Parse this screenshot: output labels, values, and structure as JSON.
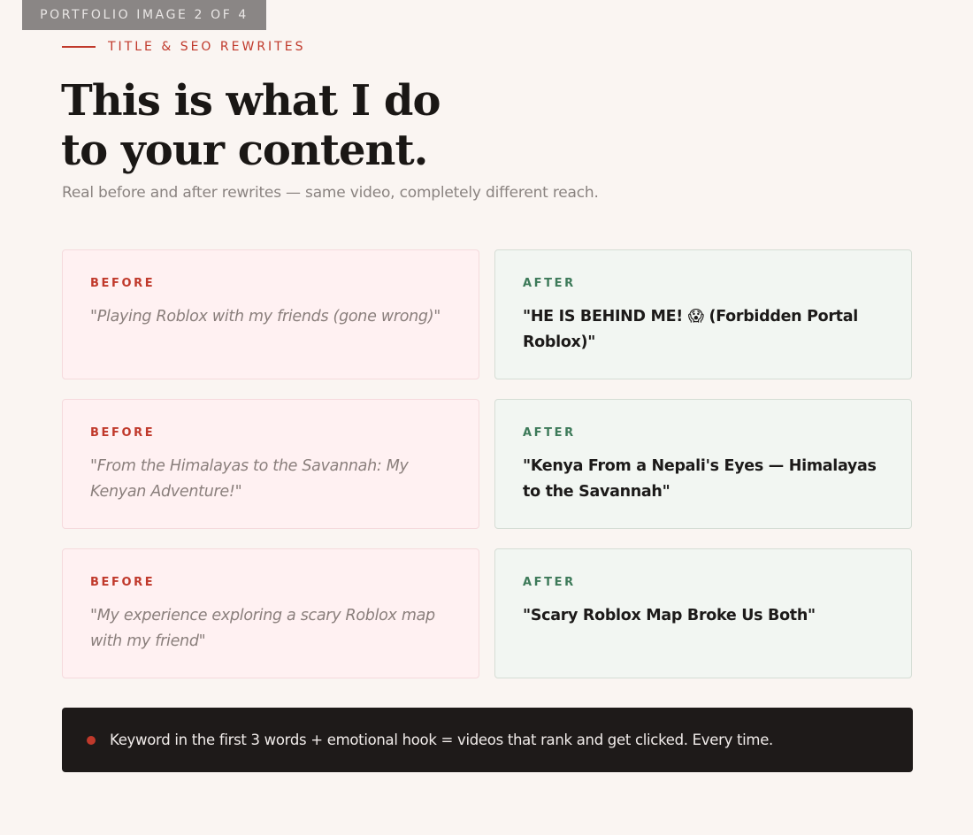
{
  "badge": "PORTFOLIO IMAGE 2 OF 4",
  "kicker": "TITLE & SEO REWRITES",
  "headline": {
    "line1": "This is what I do",
    "line2": "to your content."
  },
  "subtitle": "Real before and after rewrites — same video, completely different reach.",
  "before_label": "BEFORE",
  "after_label": "AFTER",
  "rows": [
    {
      "before": "\"Playing Roblox with my friends (gone wrong)\"",
      "after": "\"HE IS BEHIND ME! 😱 (Forbidden Portal Roblox)\""
    },
    {
      "before": "\"From the Himalayas to the Savannah: My Kenyan Adventure!\"",
      "after": "\"Kenya From a Nepali's Eyes — Himalayas to the Savannah\""
    },
    {
      "before": "\"My experience exploring a scary Roblox map with my friend\"",
      "after": "\"Scary Roblox Map Broke Us Both\""
    }
  ],
  "callout": "Keyword in the first 3 words + emotional hook = videos that rank and get clicked. Every time.",
  "colors": {
    "accent_red": "#c0392b",
    "accent_green": "#3d7a59",
    "callout_bg": "#1e1a19"
  }
}
